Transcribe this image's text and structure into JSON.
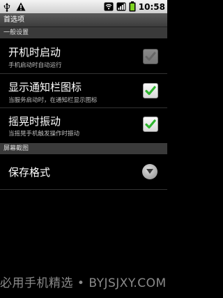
{
  "status_bar": {
    "time": "10:58",
    "icons": [
      "usb-icon",
      "warning-icon",
      "wifi-icon",
      "signal-icon",
      "battery-icon"
    ],
    "battery_level": 1.0
  },
  "title_bar": {
    "title": "首选项"
  },
  "sections": [
    {
      "header": "一般设置",
      "items": [
        {
          "title": "开机时启动",
          "summary": "手机启动时自动运行",
          "checked": false,
          "enabled": false
        },
        {
          "title": "显示通知栏图标",
          "summary": "当服务启动时，在通知栏显示图标",
          "checked": true,
          "enabled": true
        },
        {
          "title": "摇晃时振动",
          "summary": "当摇晃手机触发操作时振动",
          "checked": true,
          "enabled": true
        }
      ]
    },
    {
      "header": "屏幕截图",
      "items": [
        {
          "title": "保存格式",
          "control": "dropdown-icon"
        }
      ]
    }
  ],
  "watermark": "必用手机精选 • BYJSJXY.COM",
  "colors": {
    "background": "#000000",
    "check_green": "#2fb52f",
    "disabled_gray": "#bcbcbc",
    "section_header": "#3a3a3a"
  }
}
